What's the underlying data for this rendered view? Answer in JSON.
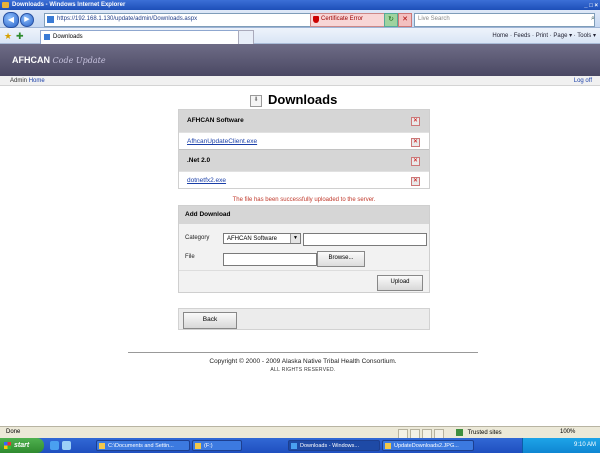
{
  "window": {
    "title": "Downloads - Windows Internet Explorer",
    "controls": "_ □ ×"
  },
  "browser": {
    "address": "https://192.168.1.130/update/admin/Downloads.aspx",
    "certificate_error": "Certificate Error",
    "search_placeholder": "Live Search",
    "tab_label": "Downloads",
    "command_bar": "Home · Feeds · Print · Page ▾ · Tools ▾",
    "back_glyph": "◀",
    "forward_glyph": "▶",
    "refresh_glyph": "↻",
    "stop_glyph": "✕",
    "search_go_glyph": "⌕",
    "fav_star_glyph": "★",
    "fav_add_glyph": "✚"
  },
  "app": {
    "brand": "AFHCAN",
    "brand_sub": "Code Update"
  },
  "adminbar": {
    "breadcrumb_prefix": "Admin",
    "breadcrumb_link": "Home",
    "logoff": "Log off"
  },
  "page": {
    "title": "Downloads",
    "title_icon_glyph": "⬇"
  },
  "downloads": {
    "sections": [
      {
        "name": "AFHCAN Software",
        "files": [
          "AfhcanUpdateClient.exe"
        ]
      },
      {
        "name": ".Net 2.0",
        "files": [
          "dotnetfx2.exe"
        ]
      }
    ],
    "delete_glyph": "✕"
  },
  "status_message": "The file has been successfully uploaded to the server.",
  "add_download": {
    "header": "Add Download",
    "category_label": "Category",
    "category_selected": "AFHCAN Software",
    "dropdown_glyph": "▼",
    "file_label": "File",
    "browse_label": "Browse...",
    "upload_label": "Upload"
  },
  "back_label": "Back",
  "footer": {
    "copyright": "Copyright © 2000 - 2009 Alaska Native Tribal Health Consortium.",
    "rights": "ALL RIGHTS RESERVED."
  },
  "statusbar": {
    "text": "Done",
    "zone": "Trusted sites",
    "zoom": "100%"
  },
  "taskbar": {
    "start": "start",
    "tasks": [
      "C:\\Documents and Settin...",
      "(F:)",
      "Downloads - Windows...",
      "UpdateDownloads2.JPG..."
    ],
    "clock": "9:10 AM"
  }
}
